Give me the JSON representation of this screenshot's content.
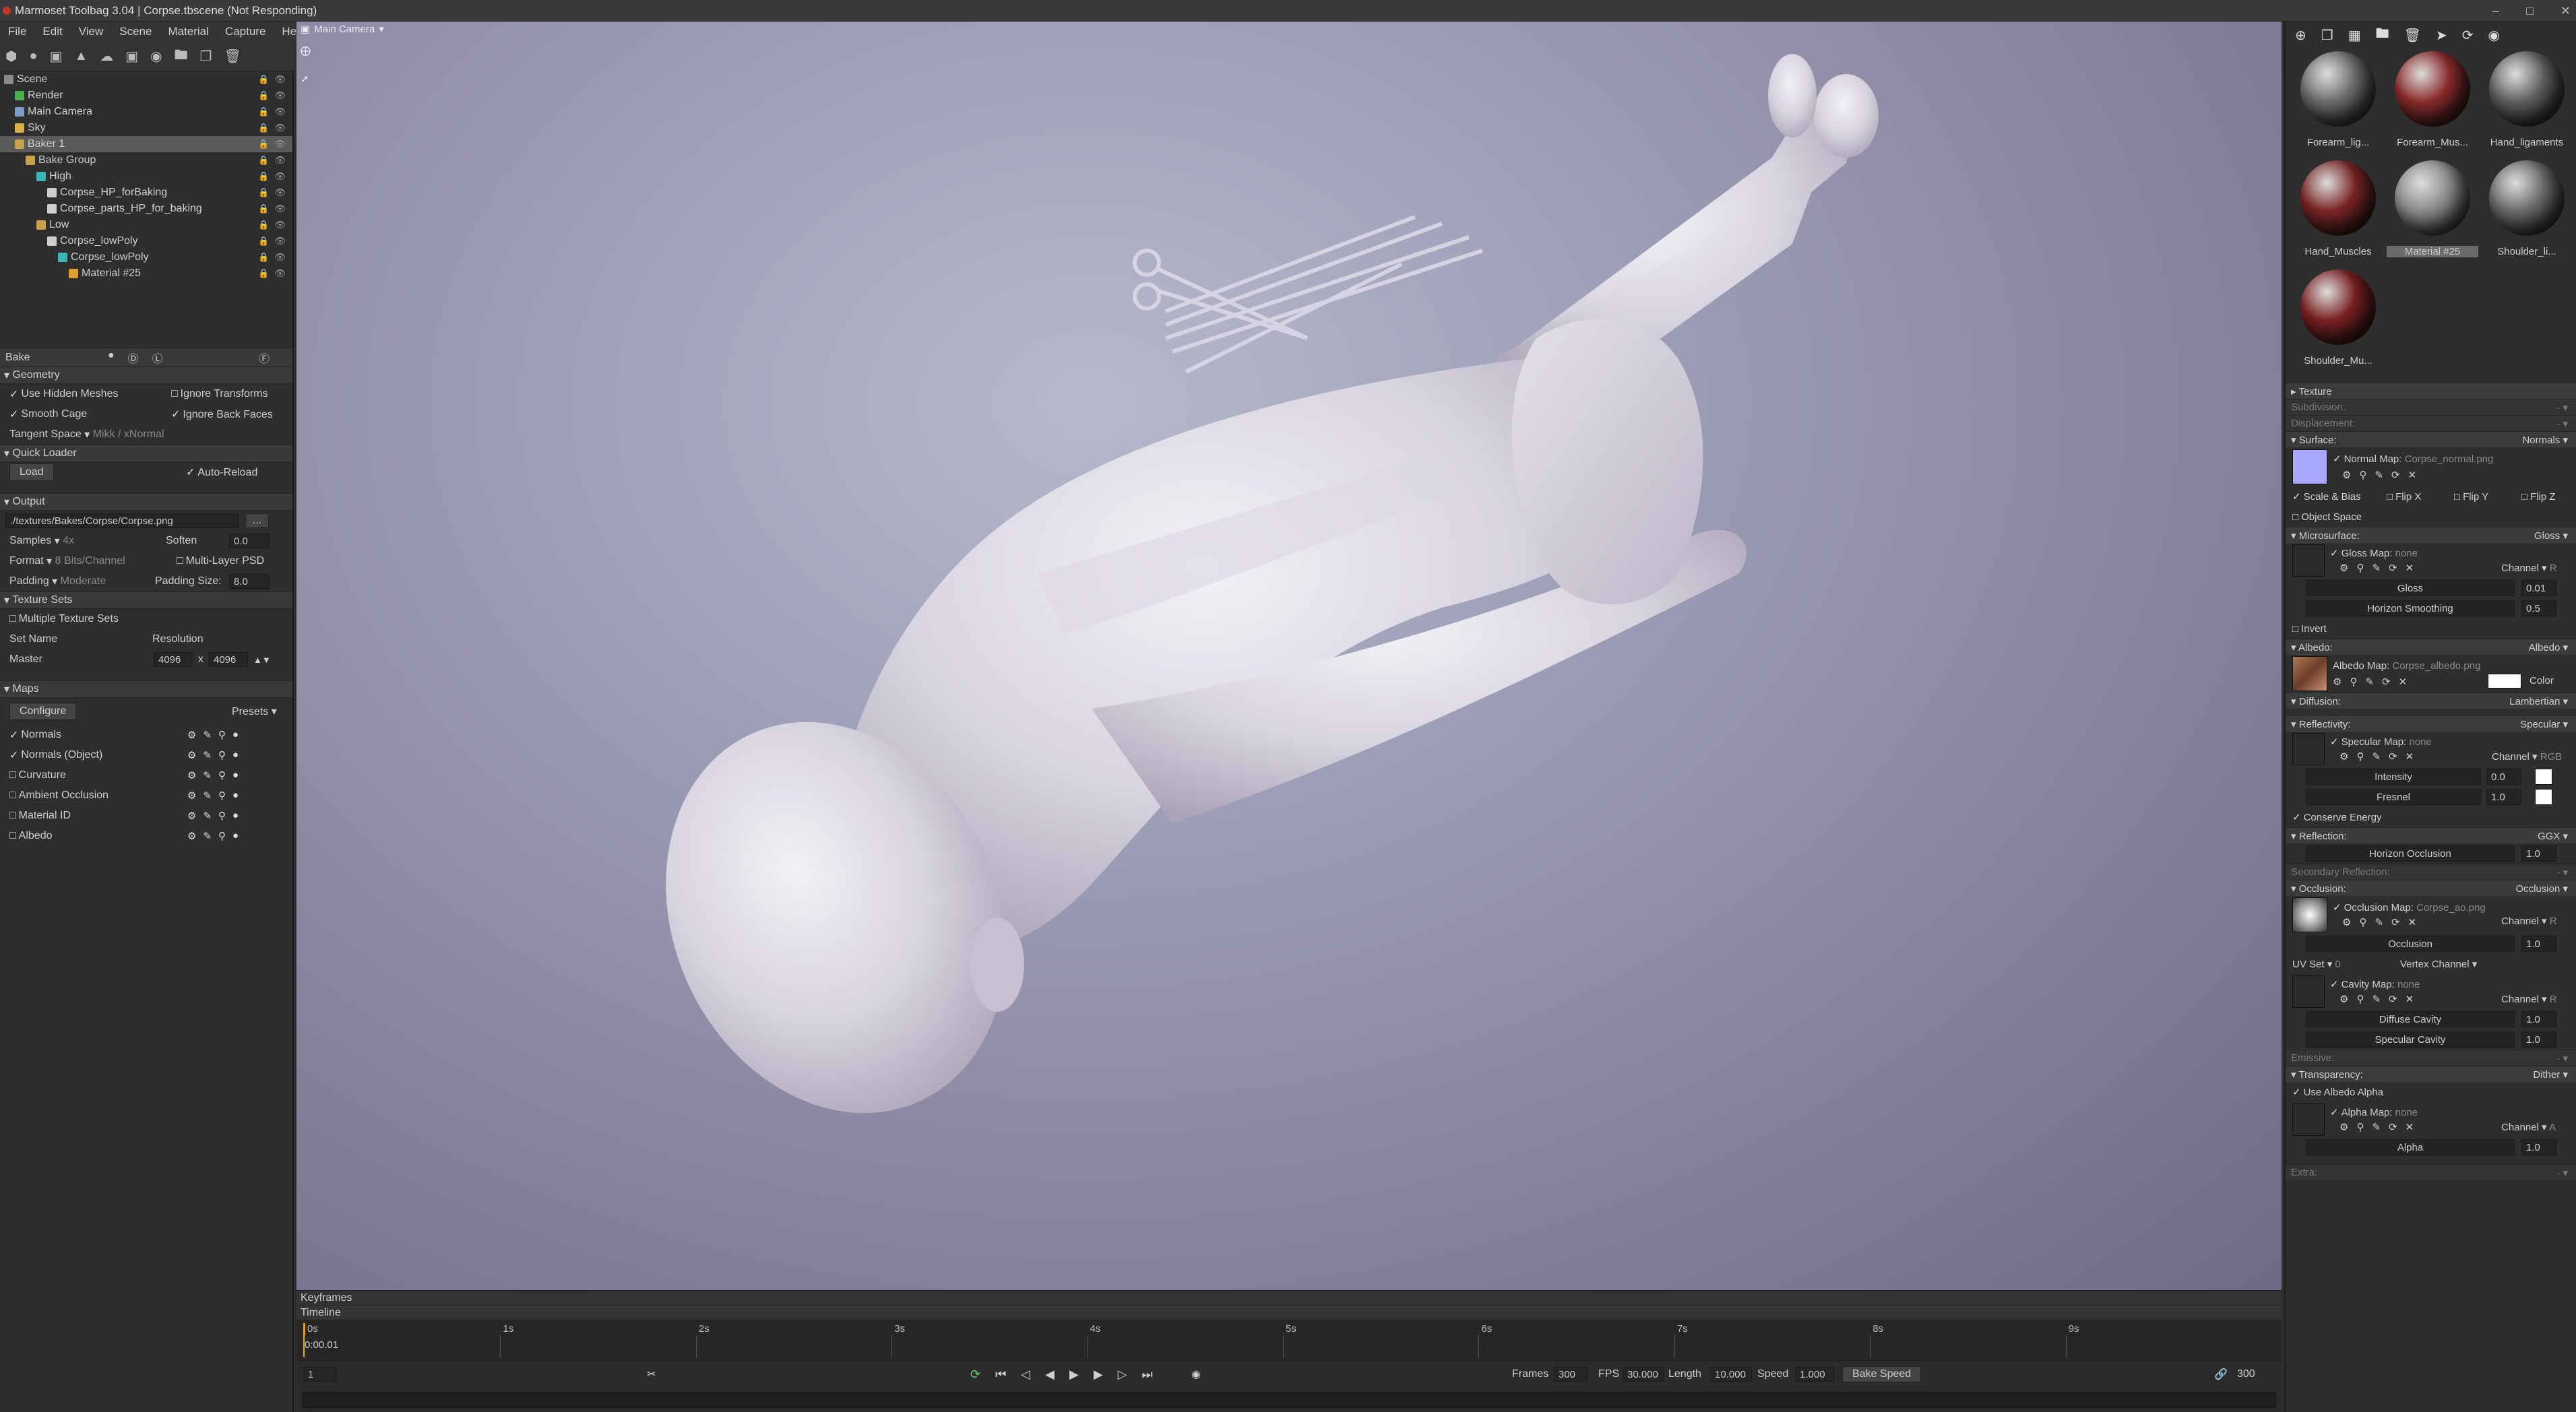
{
  "app": {
    "title": "Marmoset Toolbag 3.04  |  Corpse.tbscene (Not Responding)"
  },
  "menu": [
    "File",
    "Edit",
    "View",
    "Scene",
    "Material",
    "Capture",
    "Help"
  ],
  "scene_tree": [
    {
      "label": "Scene",
      "indent": 0,
      "color": "#8a8a8a"
    },
    {
      "label": "Render",
      "indent": 1,
      "color": "#4caf50"
    },
    {
      "label": "Main Camera",
      "indent": 1,
      "color": "#7a9cc6"
    },
    {
      "label": "Sky",
      "indent": 1,
      "color": "#d8b04a"
    },
    {
      "label": "Baker 1",
      "indent": 1,
      "color": "#c8a24a",
      "selected": true
    },
    {
      "label": "Bake Group",
      "indent": 2,
      "color": "#c8a24a"
    },
    {
      "label": "High",
      "indent": 3,
      "color": "#3bb5b5"
    },
    {
      "label": "Corpse_HP_forBaking",
      "indent": 4,
      "color": "#cfcfcf"
    },
    {
      "label": "Corpse_parts_HP_for_baking",
      "indent": 4,
      "color": "#cfcfcf"
    },
    {
      "label": "Low",
      "indent": 3,
      "color": "#c8a24a"
    },
    {
      "label": "Corpse_lowPoly",
      "indent": 4,
      "color": "#cfcfcf"
    },
    {
      "label": "Corpse_lowPoly",
      "indent": 5,
      "color": "#3bb5b5"
    },
    {
      "label": "Material #25",
      "indent": 6,
      "color": "#e0a030"
    }
  ],
  "bake": {
    "header": "Bake",
    "geometry": {
      "title": "Geometry",
      "use_hidden": "Use Hidden Meshes",
      "ignore_transforms": "Ignore Transforms",
      "smooth_cage": "Smooth Cage",
      "ignore_back": "Ignore Back Faces",
      "tangent_label": "Tangent Space",
      "tangent_value": "Mikk / xNormal"
    },
    "quick_loader": {
      "title": "Quick Loader",
      "load": "Load",
      "auto_reload": "Auto-Reload"
    },
    "output": {
      "title": "Output",
      "path": "./textures/Bakes/Corpse/Corpse.png",
      "browse": "...",
      "samples_label": "Samples",
      "samples_value": "4x",
      "soften_label": "Soften",
      "soften_value": "0.0",
      "format_label": "Format",
      "format_value": "8 Bits/Channel",
      "multilayer": "Multi-Layer PSD",
      "padding_label": "Padding",
      "padding_value": "Moderate",
      "padding_size_label": "Padding Size:",
      "padding_size_value": "8.0"
    },
    "texture_sets": {
      "title": "Texture Sets",
      "multiple": "Multiple Texture Sets",
      "set_name": "Set Name",
      "resolution": "Resolution",
      "master": "Master",
      "w": "4096",
      "x": "x",
      "h": "4096"
    },
    "maps": {
      "title": "Maps",
      "configure": "Configure",
      "presets": "Presets",
      "items": [
        {
          "label": "Normals",
          "checked": true
        },
        {
          "label": "Normals (Object)",
          "checked": true
        },
        {
          "label": "Curvature",
          "checked": false
        },
        {
          "label": "Ambient Occlusion",
          "checked": false
        },
        {
          "label": "Material ID",
          "checked": false
        },
        {
          "label": "Albedo",
          "checked": false
        }
      ]
    }
  },
  "viewport": {
    "camera": "Main Camera"
  },
  "timeline": {
    "keyframes": "Keyframes",
    "timeline": "Timeline",
    "ticks": [
      "0s",
      "1s",
      "2s",
      "3s",
      "4s",
      "5s",
      "6s",
      "7s",
      "8s",
      "9s"
    ],
    "current_time": "0:00.01",
    "frame_field": "1",
    "frames_label": "Frames",
    "frames_value": "300",
    "fps_label": "FPS",
    "fps_value": "30.000",
    "length_label": "Length",
    "length_value": "10.000",
    "speed_label": "Speed",
    "speed_value": "1.000",
    "bake_speed": "Bake Speed",
    "end_frame": "300"
  },
  "materials": [
    {
      "label": "Forearm_lig...",
      "color": "#6a6a6a"
    },
    {
      "label": "Forearm_Mus...",
      "color": "#8a2a2a"
    },
    {
      "label": "Hand_ligaments",
      "color": "#5e5e5e"
    },
    {
      "label": "Hand_Muscles",
      "color": "#7a2424"
    },
    {
      "label": "Material #25",
      "color": "#8a8a8a",
      "selected": true
    },
    {
      "label": "Shoulder_li...",
      "color": "#6a6a6a"
    },
    {
      "label": "Shoulder_Mu...",
      "color": "#7a2020"
    }
  ],
  "material_editor": {
    "texture": "Texture",
    "subdivision": "Subdivision:",
    "displacement": "Displacement:",
    "surface": "Surface:",
    "surface_mode": "Normals",
    "normal_map_label": "Normal Map:",
    "normal_map_file": "Corpse_normal.png",
    "scale_bias": "Scale & Bias",
    "flip_x": "Flip X",
    "flip_y": "Flip Y",
    "flip_z": "Flip Z",
    "object_space": "Object Space",
    "microsurface": "Microsurface:",
    "micro_mode": "Gloss",
    "gloss_map_label": "Gloss Map:",
    "gloss_map_file": "none",
    "channel": "Channel",
    "channel_r": "R",
    "gloss": "Gloss",
    "gloss_value": "0.01",
    "horizon_smoothing": "Horizon Smoothing",
    "horizon_value": "0.5",
    "invert": "Invert",
    "albedo": "Albedo:",
    "albedo_mode": "Albedo",
    "albedo_map_label": "Albedo Map:",
    "albedo_map_file": "Corpse_albedo.png",
    "color": "Color",
    "diffusion": "Diffusion:",
    "diffusion_mode": "Lambertian",
    "reflectivity": "Reflectivity:",
    "reflect_mode": "Specular",
    "specular_map_label": "Specular Map:",
    "specular_map_file": "none",
    "channel_rgb": "RGB",
    "intensity": "Intensity",
    "intensity_value": "0.0",
    "fresnel": "Fresnel",
    "fresnel_value": "1.0",
    "conserve": "Conserve Energy",
    "reflection": "Reflection:",
    "reflection_mode": "GGX",
    "horizon_occlusion": "Horizon Occlusion",
    "horizon_occ_value": "1.0",
    "secondary": "Secondary Reflection:",
    "occlusion": "Occlusion:",
    "occlusion_mode": "Occlusion",
    "occlusion_map_label": "Occlusion Map:",
    "occlusion_map_file": "Corpse_ao.png",
    "occlusion_label": "Occlusion",
    "occlusion_value": "1.0",
    "uv_set": "UV Set",
    "uv_value": "0",
    "vertex_channel": "Vertex Channel",
    "cavity_map_label": "Cavity Map:",
    "cavity_map_file": "none",
    "diffuse_cavity": "Diffuse Cavity",
    "diffuse_cavity_value": "1.0",
    "specular_cavity": "Specular Cavity",
    "specular_cavity_value": "1.0",
    "emissive": "Emissive:",
    "transparency": "Transparency:",
    "transparency_mode": "Dither",
    "use_albedo_alpha": "Use Albedo Alpha",
    "alpha_map_label": "Alpha Map:",
    "alpha_map_file": "none",
    "channel_a": "A",
    "alpha": "Alpha",
    "alpha_value": "1.0",
    "extra": "Extra:"
  }
}
